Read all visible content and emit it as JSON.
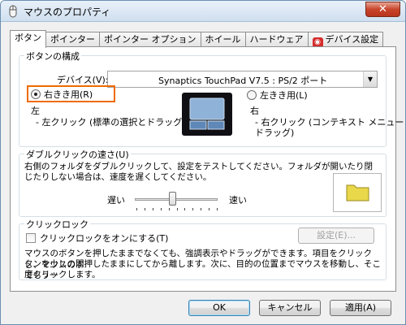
{
  "window": {
    "title": "マウスのプロパティ",
    "close_label": "✕"
  },
  "tabs": [
    {
      "label": "ボタン"
    },
    {
      "label": "ポインター"
    },
    {
      "label": "ポインター オプション"
    },
    {
      "label": "ホイール"
    },
    {
      "label": "ハードウェア"
    },
    {
      "label": "デバイス設定"
    }
  ],
  "button_config": {
    "group_title": "ボタンの構成",
    "device_label": "デバイス(V):",
    "device_value": "Synaptics TouchPad V7.5 : PS/2 ポート",
    "right_handed_label": "右きき用(R)",
    "left_handed_label": "左きき用(L)",
    "left_title": "左",
    "left_desc": "- 左クリック (標準の選択とドラッグ)",
    "right_title": "右",
    "right_desc_1": "- 右クリック (コンテキスト メニューと補助",
    "right_desc_2": "ドラッグ)"
  },
  "double_click": {
    "group_title": "ダブルクリックの速さ(U)",
    "desc_1": "右側のフォルダをダブルクリックして、設定をテストしてください。フォルダが開いたり閉",
    "desc_2": "じたりしない場合は、速度を遅くしてください。",
    "slow_label": "遅い",
    "fast_label": "速い",
    "speed_level": 0.45
  },
  "click_lock": {
    "group_title": "クリックロック",
    "checkbox_label": "クリックロックをオンにする(T)",
    "checked": false,
    "settings_button": "設定(E)...",
    "desc_1": "マウスのボタンを押したままでなくても、強調表示やドラッグができます。項目をクリックし、マウスのボ",
    "desc_2": "タンを少しの間押したままにしてから離します。次に、目的の位置までマウスを移動し、そこでもう一",
    "desc_3": "度クリックします。"
  },
  "footer": {
    "ok": "OK",
    "cancel": "キャンセル",
    "apply": "適用(A)"
  },
  "colors": {
    "highlight": "#ef6b00",
    "folder": "#e8d84a"
  }
}
